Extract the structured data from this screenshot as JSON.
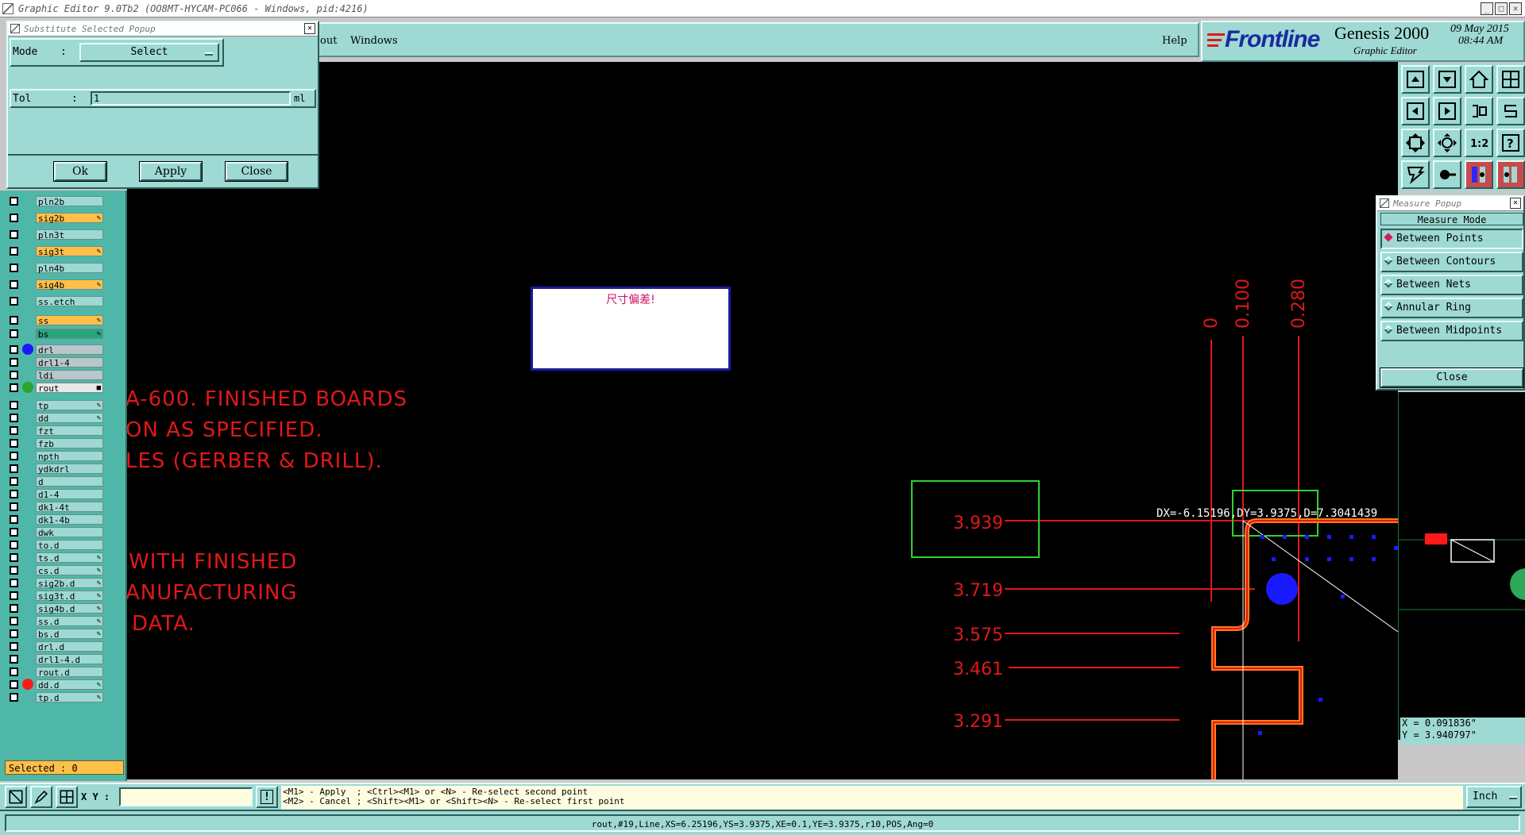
{
  "titlebar": {
    "title": "Graphic Editor 9.0Tb2 (OO8MT-HYCAM-PC066 - Windows, pid:4216)"
  },
  "menu": {
    "left_item": "out",
    "windows": "Windows",
    "help": "Help"
  },
  "brand": {
    "logo": "Frontline",
    "product": "Genesis 2000",
    "subtitle": "Graphic Editor",
    "date": "09 May 2015",
    "time": "08:44 AM"
  },
  "substitute_popup": {
    "title": "Substitute Selected Popup",
    "mode_label": "Mode",
    "mode_sep": ":",
    "mode_value": "Select",
    "tol_label": "Tol",
    "tol_sep": ":",
    "tol_value": "1",
    "tol_unit": "ml",
    "ok": "Ok",
    "apply": "Apply",
    "close": "Close"
  },
  "layers": [
    {
      "name": "pln2b",
      "color": "#9ed9d3",
      "dot": "",
      "pen": ""
    },
    {
      "name": "sig2b",
      "color": "#ffc04a",
      "dot": "",
      "pen": "✎"
    },
    {
      "name": "pln3t",
      "color": "#9ed9d3",
      "dot": "",
      "pen": ""
    },
    {
      "name": "sig3t",
      "color": "#ffc04a",
      "dot": "",
      "pen": "✎"
    },
    {
      "name": "pln4b",
      "color": "#9ed9d3",
      "dot": "",
      "pen": ""
    },
    {
      "name": "sig4b",
      "color": "#ffc04a",
      "dot": "",
      "pen": "✎"
    },
    {
      "name": "ss.etch",
      "color": "#9ed9d3",
      "dot": "",
      "pen": ""
    },
    {
      "name": "ss",
      "color": "#ffc04a",
      "dot": "",
      "pen": "✎"
    },
    {
      "name": "bs",
      "color": "#2ca37d",
      "dot": "",
      "pen": "✎"
    },
    {
      "name": "drl",
      "color": "#b8c7c9",
      "dot": "#1a1aff",
      "pen": ""
    },
    {
      "name": "drl1-4",
      "color": "#b8c7c9",
      "dot": "",
      "pen": ""
    },
    {
      "name": "ldi",
      "color": "#b8c7c9",
      "dot": "",
      "pen": ""
    },
    {
      "name": "rout",
      "color": "#e8e8e8",
      "dot": "#2ca32c",
      "pen": "■"
    },
    {
      "name": "tp",
      "color": "#9ed9d3",
      "dot": "",
      "pen": "✎"
    },
    {
      "name": "dd",
      "color": "#9ed9d3",
      "dot": "",
      "pen": "✎"
    },
    {
      "name": "fzt",
      "color": "#9ed9d3",
      "dot": "",
      "pen": ""
    },
    {
      "name": "fzb",
      "color": "#9ed9d3",
      "dot": "",
      "pen": ""
    },
    {
      "name": "npth",
      "color": "#9ed9d3",
      "dot": "",
      "pen": ""
    },
    {
      "name": "ydkdrl",
      "color": "#9ed9d3",
      "dot": "",
      "pen": ""
    },
    {
      "name": "d",
      "color": "#9ed9d3",
      "dot": "",
      "pen": ""
    },
    {
      "name": "d1-4",
      "color": "#9ed9d3",
      "dot": "",
      "pen": ""
    },
    {
      "name": "dk1-4t",
      "color": "#9ed9d3",
      "dot": "",
      "pen": ""
    },
    {
      "name": "dk1-4b",
      "color": "#9ed9d3",
      "dot": "",
      "pen": ""
    },
    {
      "name": "dwk",
      "color": "#9ed9d3",
      "dot": "",
      "pen": ""
    },
    {
      "name": "to.d",
      "color": "#9ed9d3",
      "dot": "",
      "pen": ""
    },
    {
      "name": "ts.d",
      "color": "#9ed9d3",
      "dot": "",
      "pen": "✎"
    },
    {
      "name": "cs.d",
      "color": "#9ed9d3",
      "dot": "",
      "pen": "✎"
    },
    {
      "name": "sig2b.d",
      "color": "#9ed9d3",
      "dot": "",
      "pen": "✎"
    },
    {
      "name": "sig3t.d",
      "color": "#9ed9d3",
      "dot": "",
      "pen": "✎"
    },
    {
      "name": "sig4b.d",
      "color": "#9ed9d3",
      "dot": "",
      "pen": "✎"
    },
    {
      "name": "ss.d",
      "color": "#9ed9d3",
      "dot": "",
      "pen": "✎"
    },
    {
      "name": "bs.d",
      "color": "#9ed9d3",
      "dot": "",
      "pen": "✎"
    },
    {
      "name": "drl.d",
      "color": "#9ed9d3",
      "dot": "",
      "pen": ""
    },
    {
      "name": "drl1-4.d",
      "color": "#9ed9d3",
      "dot": "",
      "pen": ""
    },
    {
      "name": "rout.d",
      "color": "#9ed9d3",
      "dot": "",
      "pen": ""
    },
    {
      "name": "dd.d",
      "color": "#9ed9d3",
      "dot": "#ff1a1a",
      "pen": "✎"
    },
    {
      "name": "tp.d",
      "color": "#9ed9d3",
      "dot": "",
      "pen": "✎"
    }
  ],
  "selected": {
    "label": "Selected : 0"
  },
  "canvas": {
    "alert_text": "尺寸偏差!",
    "notes": [
      "A-600. FINISHED BOARDS",
      "ON AS SPECIFIED.",
      "LES (GERBER & DRILL).",
      "WITH FINISHED",
      "ANUFACTURING",
      "DATA."
    ],
    "dims_vertical": [
      "0",
      "0.100",
      "0.280"
    ],
    "dims_horizontal": [
      "3.939",
      "3.719",
      "3.575",
      "3.461",
      "3.291"
    ],
    "measure_readout": "DX=-6.15196,DY=3.9375,D=7.3041439",
    "coord_x": "X = 0.091836\"",
    "coord_y": "Y = 3.940797\""
  },
  "measure_popup": {
    "title": "Measure Popup",
    "header": "Measure Mode",
    "options": [
      "Between Points",
      "Between Contours",
      "Between Nets",
      "Annular Ring",
      "Between Midpoints"
    ],
    "selected_option": "Between Points",
    "close": "Close"
  },
  "bottom": {
    "xy_label": "X Y :",
    "xy_value": "",
    "hint_line1": "<M1> - Apply  ; <Ctrl><M1> or <N> - Re-select second point",
    "hint_line2": "<M2> - Cancel ; <Shift><M1> or <Shift><N> - Re-select first point",
    "units": "Inch",
    "status": "rout,#19,Line,XS=6.25196,YS=3.9375,XE=0.1,YE=3.9375,r10,POS,Ang=0"
  },
  "colors": {
    "panel": "#9ed9d3",
    "panel_dark": "#4fb7a8",
    "canvas": "#000000",
    "drawing_red": "#e01818",
    "highlight_green": "#2fd12f",
    "trace_orange": "#ff7a1a",
    "pad_blue": "#1a1aff"
  },
  "icons": [
    "app-icon",
    "minimize-icon",
    "maximize-icon",
    "close-icon",
    "dropdown-icon",
    "flip-icon",
    "pan-left-icon",
    "pan-right-icon",
    "split-icon",
    "zoom-fit-icon",
    "one-to-two-icon",
    "help-icon",
    "layers-icon",
    "snap-icon",
    "warning-icon"
  ]
}
